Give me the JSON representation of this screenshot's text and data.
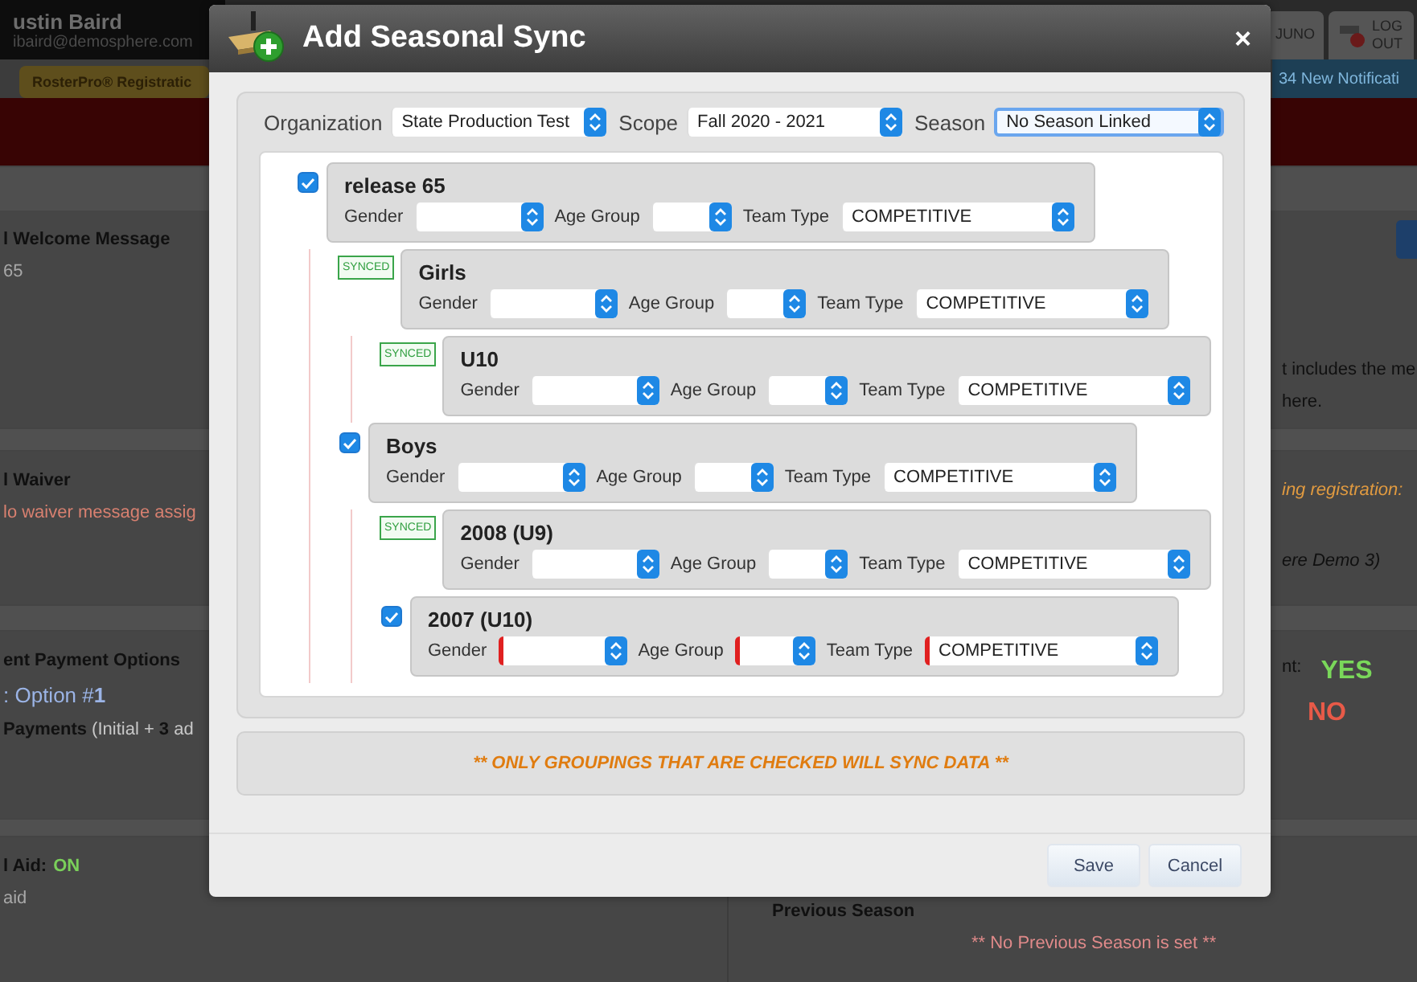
{
  "background": {
    "user": {
      "name": "ustin Baird",
      "email": "ibaird@demosphere.com"
    },
    "header_tabs": [
      {
        "label": "JUNO",
        "kind": "tab"
      },
      {
        "label": "LOG OUT",
        "kind": "logout"
      }
    ],
    "nav_tab": "RosterPro® Registratic",
    "notifications": "34 New Notificati",
    "left_sections": [
      {
        "title": "l Welcome Message",
        "lines": [
          {
            "text": "65",
            "kind": "muted"
          }
        ]
      },
      {
        "title": "l Waiver",
        "lines": [
          {
            "text": "lo waiver message assig",
            "kind": "error"
          }
        ]
      },
      {
        "title": "ent Payment Options",
        "lines": [
          {
            "text": ": Option #**1**",
            "kind": "link"
          },
          {
            "text": "**Payments** (Initial + **3** ad",
            "kind": "payment"
          }
        ]
      },
      {
        "title": "l Aid:",
        "status": "ON",
        "lines": [
          {
            "text": "aid",
            "kind": "muted"
          }
        ]
      }
    ],
    "right_sections": [
      {
        "lines": [
          {
            "text": "t includes the me",
            "kind": "plain"
          },
          {
            "text": "here.",
            "kind": "plain"
          }
        ]
      },
      {
        "lines": [
          {
            "text": "ing registration:",
            "kind": "warning"
          },
          {
            "text": "ere Demo 3)",
            "kind": "note"
          }
        ]
      },
      {
        "lines": [
          {
            "text": "nt:",
            "kind": "plain",
            "value": "YES",
            "positive": true
          },
          {
            "value": "NO",
            "positive": false
          }
        ]
      },
      {
        "title": "Previous Season",
        "lines": [
          {
            "text": "** No Previous Season is set **",
            "kind": "empty"
          }
        ]
      }
    ]
  },
  "dialog": {
    "title": "Add Seasonal Sync",
    "close": "×",
    "filters": [
      {
        "label": "Organization",
        "value": "State Production Test",
        "focused": false
      },
      {
        "label": "Scope",
        "value": "Fall 2020 - 2021",
        "focused": false
      },
      {
        "label": "Season",
        "value": "No Season Linked",
        "focused": true
      }
    ],
    "tree": [
      {
        "name": "release 65",
        "kind": "checkbox",
        "checked": true,
        "error": false,
        "fields": [
          {
            "label": "Gender"
          },
          {
            "label": "Age Group"
          },
          {
            "label": "Team Type",
            "value": "COMPETITIVE"
          }
        ],
        "children": [
          {
            "name": "Girls",
            "kind": "synced",
            "badge": "SYNCED",
            "error": false,
            "fields": [
              {
                "label": "Gender"
              },
              {
                "label": "Age Group"
              },
              {
                "label": "Team Type",
                "value": "COMPETITIVE"
              }
            ],
            "children": [
              {
                "name": "U10",
                "kind": "synced",
                "badge": "SYNCED",
                "error": false,
                "fields": [
                  {
                    "label": "Gender"
                  },
                  {
                    "label": "Age Group"
                  },
                  {
                    "label": "Team Type",
                    "value": "COMPETITIVE"
                  }
                ]
              }
            ]
          },
          {
            "name": "Boys",
            "kind": "checkbox",
            "checked": true,
            "error": false,
            "fields": [
              {
                "label": "Gender"
              },
              {
                "label": "Age Group"
              },
              {
                "label": "Team Type",
                "value": "COMPETITIVE"
              }
            ],
            "children": [
              {
                "name": "2008 (U9)",
                "kind": "synced",
                "badge": "SYNCED",
                "error": false,
                "fields": [
                  {
                    "label": "Gender"
                  },
                  {
                    "label": "Age Group"
                  },
                  {
                    "label": "Team Type",
                    "value": "COMPETITIVE"
                  }
                ]
              },
              {
                "name": "2007 (U10)",
                "kind": "checkbox",
                "checked": true,
                "error": true,
                "fields": [
                  {
                    "label": "Gender"
                  },
                  {
                    "label": "Age Group"
                  },
                  {
                    "label": "Team Type",
                    "value": "COMPETITIVE"
                  }
                ]
              }
            ]
          }
        ]
      }
    ],
    "notice": "** ONLY GROUPINGS THAT ARE CHECKED WILL SYNC DATA **",
    "buttons": [
      "Save",
      "Cancel"
    ]
  }
}
